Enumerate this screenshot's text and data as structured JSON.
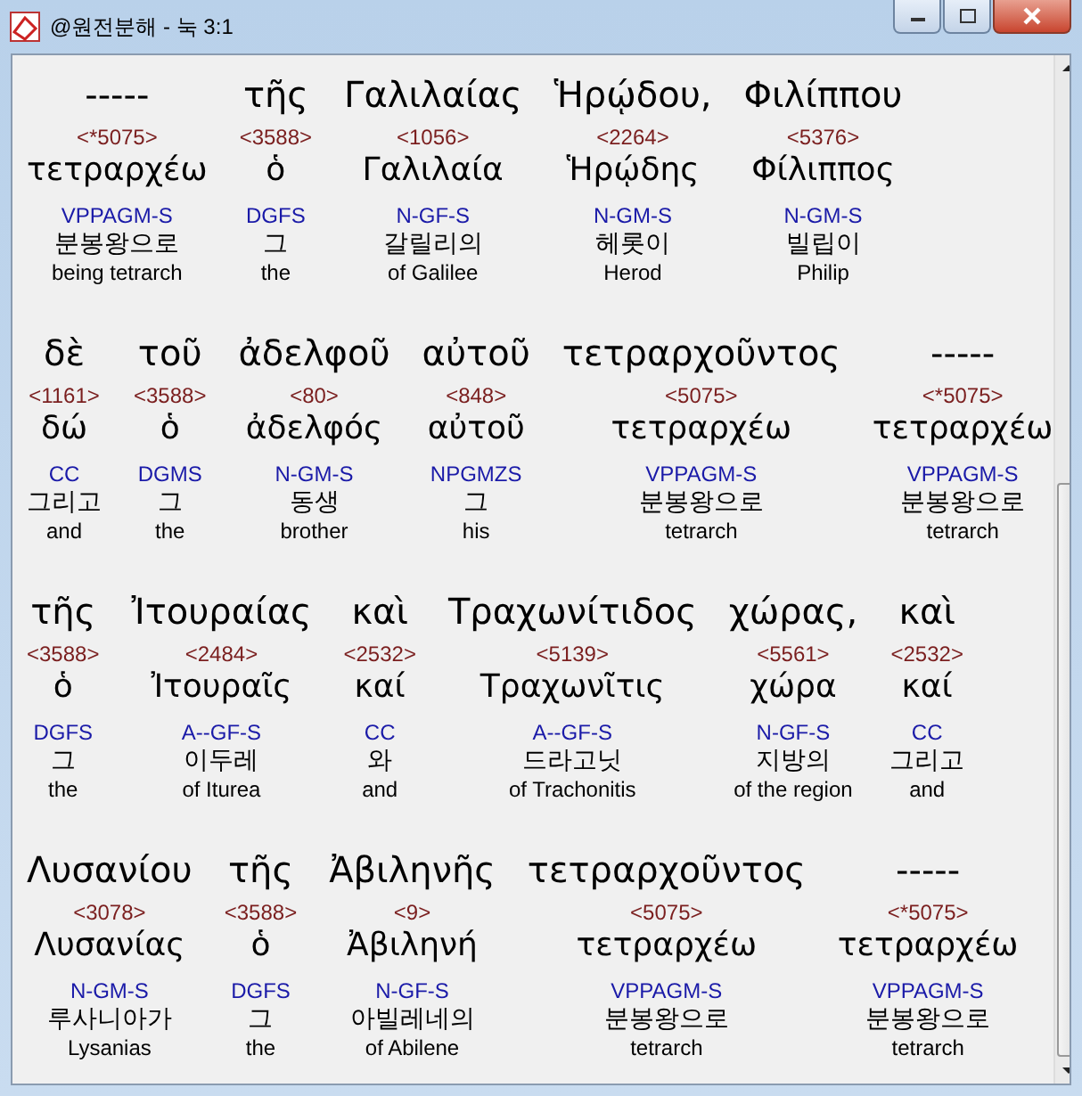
{
  "window": {
    "title": "@원전분해 - 눅 3:1"
  },
  "lines": [
    {
      "words": [
        {
          "surface": "-----",
          "strong": "<*5075>",
          "lemma": "τετραρχέω",
          "parse": "VPPAGM-S",
          "korean": "분봉왕으로",
          "english": "being tetrarch"
        },
        {
          "surface": "τῆς",
          "strong": "<3588>",
          "lemma": "ὁ",
          "parse": "DGFS",
          "korean": "그",
          "english": "the"
        },
        {
          "surface": "Γαλιλαίας",
          "strong": "<1056>",
          "lemma": "Γαλιλαία",
          "parse": "N-GF-S",
          "korean": "갈릴리의",
          "english": "of Galilee"
        },
        {
          "surface": "Ἡρῴδου,",
          "strong": "<2264>",
          "lemma": "Ἡρῴδης",
          "parse": "N-GM-S",
          "korean": "헤롯이",
          "english": "Herod"
        },
        {
          "surface": "Φιλίππου",
          "strong": "<5376>",
          "lemma": "Φίλιππος",
          "parse": "N-GM-S",
          "korean": "빌립이",
          "english": "Philip"
        }
      ]
    },
    {
      "words": [
        {
          "surface": "δὲ",
          "strong": "<1161>",
          "lemma": "δώ",
          "parse": "CC",
          "korean": "그리고",
          "english": "and"
        },
        {
          "surface": "τοῦ",
          "strong": "<3588>",
          "lemma": "ὁ",
          "parse": "DGMS",
          "korean": "그",
          "english": "the"
        },
        {
          "surface": "ἀδελφοῦ",
          "strong": "<80>",
          "lemma": "ἀδελφός",
          "parse": "N-GM-S",
          "korean": "동생",
          "english": "brother"
        },
        {
          "surface": "αὐτοῦ",
          "strong": "<848>",
          "lemma": "αὐτοῦ",
          "parse": "NPGMZS",
          "korean": "그",
          "english": "his"
        },
        {
          "surface": "τετραρχοῦντος",
          "strong": "<5075>",
          "lemma": "τετραρχέω",
          "parse": "VPPAGM-S",
          "korean": "분봉왕으로",
          "english": "tetrarch"
        },
        {
          "surface": "-----",
          "strong": "<*5075>",
          "lemma": "τετραρχέω",
          "parse": "VPPAGM-S",
          "korean": "분봉왕으로",
          "english": "tetrarch"
        }
      ]
    },
    {
      "words": [
        {
          "surface": "τῆς",
          "strong": "<3588>",
          "lemma": "ὁ",
          "parse": "DGFS",
          "korean": "그",
          "english": "the"
        },
        {
          "surface": "Ἰτουραίας",
          "strong": "<2484>",
          "lemma": "Ἰτουραῖς",
          "parse": "A--GF-S",
          "korean": "이두레",
          "english": "of Iturea"
        },
        {
          "surface": "καὶ",
          "strong": "<2532>",
          "lemma": "καί",
          "parse": "CC",
          "korean": "와",
          "english": "and"
        },
        {
          "surface": "Τραχωνίτιδος",
          "strong": "<5139>",
          "lemma": "Τραχωνῖτις",
          "parse": "A--GF-S",
          "korean": "드라고닛",
          "english": "of Trachonitis"
        },
        {
          "surface": "χώρας,",
          "strong": "<5561>",
          "lemma": "χώρα",
          "parse": "N-GF-S",
          "korean": "지방의",
          "english": "of the region"
        },
        {
          "surface": "καὶ",
          "strong": "<2532>",
          "lemma": "καί",
          "parse": "CC",
          "korean": "그리고",
          "english": "and"
        }
      ]
    },
    {
      "words": [
        {
          "surface": "Λυσανίου",
          "strong": "<3078>",
          "lemma": "Λυσανίας",
          "parse": "N-GM-S",
          "korean": "루사니아가",
          "english": "Lysanias"
        },
        {
          "surface": "τῆς",
          "strong": "<3588>",
          "lemma": "ὁ",
          "parse": "DGFS",
          "korean": "그",
          "english": "the"
        },
        {
          "surface": "Ἀβιληνῆς",
          "strong": "<9>",
          "lemma": "Ἀβιληνή",
          "parse": "N-GF-S",
          "korean": "아빌레네의",
          "english": "of Abilene"
        },
        {
          "surface": "τετραρχοῦντος",
          "strong": "<5075>",
          "lemma": "τετραρχέω",
          "parse": "VPPAGM-S",
          "korean": "분봉왕으로",
          "english": "tetrarch"
        },
        {
          "surface": "-----",
          "strong": "<*5075>",
          "lemma": "τετραρχέω",
          "parse": "VPPAGM-S",
          "korean": "분봉왕으로",
          "english": "tetrarch"
        }
      ]
    }
  ]
}
